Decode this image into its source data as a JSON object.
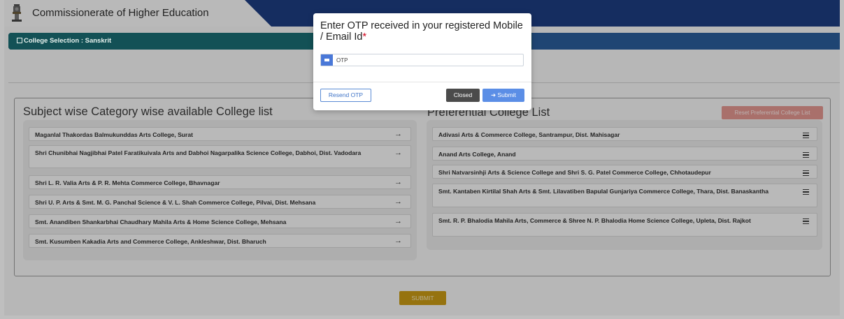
{
  "header": {
    "app_title": "Commissionerate of Higher Education",
    "brand_color": "#1c3c80"
  },
  "section": {
    "title": "College Selection : Sanskrit"
  },
  "left_panel": {
    "title": "Subject wise Category wise available College list",
    "items": [
      "Maganlal Thakordas Balmukunddas Arts College, Surat",
      "Shri Chunibhai Nagjibhai Patel Faratikuivala Arts and Dabhoi Nagarpalika Science College, Dabhoi, Dist. Vadodara",
      "Shri L. R. Valia Arts & P. R. Mehta Commerce College, Bhavnagar",
      "Shri U. P. Arts & Smt. M. G. Panchal Science & V. L. Shah Commerce College, Pilvai, Dist. Mehsana",
      "Smt. Anandiben Shankarbhai Chaudhary Mahila Arts & Home Science College, Mehsana",
      "Smt. Kusumben Kakadia Arts and Commerce College, Ankleshwar, Dist. Bharuch"
    ]
  },
  "right_panel": {
    "title": "Preferential College List",
    "reset_label": "Reset Preferential College List",
    "items": [
      "Adivasi Arts & Commerce College, Santrampur, Dist. Mahisagar",
      "Anand Arts College, Anand",
      "Shri Natvarsinhji Arts & Science College and Shri S. G. Patel Commerce College, Chhotaudepur",
      "Smt. Kantaben Kirtilal Shah Arts & Smt. Lilavatiben Bapulal Gunjariya Commerce College, Thara, Dist. Banaskantha",
      "Smt. R. P. Bhalodia Mahila Arts, Commerce & Shree N. P. Bhalodia Home Science College, Upleta, Dist. Rajkot"
    ]
  },
  "submit_label": "SUBMIT",
  "modal": {
    "title": "Enter OTP received in your registered Mobile / Email Id",
    "required_mark": "*",
    "otp_placeholder": "OTP",
    "resend_label": "Resend OTP",
    "closed_label": "Closed",
    "submit_label": "Submit"
  },
  "icons": {
    "emblem": "national-emblem-icon",
    "section": "list-icon",
    "add": "arrow-right-icon",
    "reorder": "hamburger-icon",
    "otp": "envelope-icon",
    "submit": "sign-in-icon"
  }
}
